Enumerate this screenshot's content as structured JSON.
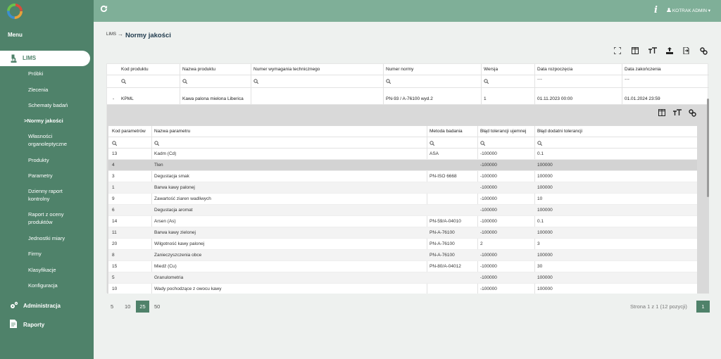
{
  "sidebar": {
    "menu_label": "Menu",
    "lims_label": "LIMS",
    "sub_items": [
      "Próbki",
      "Zlecenia",
      "Schematy badań",
      ">Normy jakości",
      "Własności",
      "organoleptyczne",
      "Produkty",
      "Parametry",
      "Dzienny raport",
      "kontrolny",
      "Raport z oceny",
      "produktów",
      "Jednostki miary",
      "Firmy",
      "Klasyfikacje",
      "Konfiguracja"
    ],
    "admin_label": "Administracja",
    "reports_label": "Raporty"
  },
  "topbar": {
    "refresh_icon": "refresh-icon",
    "info_icon": "i",
    "user_label": "KOTRAK ADMIN ▾"
  },
  "breadcrumb": {
    "root": "LIMS",
    "arrow": "→",
    "current": "Normy jakości"
  },
  "master": {
    "columns": [
      "Kod produktu",
      "Nazwa produktu",
      "Numer wymagania technicznego",
      "Numer normy",
      "Wersja",
      "Data rozpoczęcia",
      "Data zakończenia"
    ],
    "filter_date_placeholder": "---",
    "row": {
      "expander": "-",
      "code": "KPML",
      "name": "Kawa palona mielona Liberica",
      "req": "",
      "norm": "PN-93 / A-76100 wyd.2",
      "version": "1",
      "start": "01.11.2023 00:00",
      "end": "01.01.2024 23:59"
    }
  },
  "detail": {
    "columns": [
      "Kod parametrów",
      "Nazwa parametru",
      "Metoda badania",
      "Błąd tolerancji ujemnej",
      "Błąd dodatni tolerancji"
    ],
    "rows": [
      [
        "13",
        "Kadm (Cd)",
        "ASA",
        "-100000",
        "0.1"
      ],
      [
        "4",
        "Tlen",
        "",
        "-100000",
        "100000"
      ],
      [
        "3",
        "Degustacja smak",
        "PN-ISO 6668",
        "-100000",
        "100000"
      ],
      [
        "1",
        "Barwa kawy palonej",
        "",
        "-100000",
        "100000"
      ],
      [
        "9",
        "Zawartość ziaren wadliwych",
        "",
        "-100000",
        "10"
      ],
      [
        "6",
        "Degustacja aromat",
        "",
        "-100000",
        "100000"
      ],
      [
        "14",
        "Arsen (As)",
        "PN-59/A-04010",
        "-100000",
        "0.1"
      ],
      [
        "11",
        "Barwa kawy zielonej",
        "PN-A-76100",
        "-100000",
        "100000"
      ],
      [
        "20",
        "Wilgotność kawy palonej",
        "PN-A-76100",
        "2",
        "3"
      ],
      [
        "8",
        "Zanieczyszczenia obce",
        "PN-A-76100",
        "-100000",
        "100000"
      ],
      [
        "15",
        "Miedź (Cu)",
        "PN-80/A-04012",
        "-100000",
        "30"
      ],
      [
        "5",
        "Granulometria",
        "",
        "-100000",
        "100000"
      ],
      [
        "10",
        "Wady pochodzące z owocu kawy",
        "",
        "-100000",
        "100000"
      ]
    ]
  },
  "pagination": {
    "sizes": [
      "5",
      "10",
      "25",
      "50"
    ],
    "active_size": "25",
    "info": "Strona 1 z 1 (12 pozycji)",
    "page": "1"
  },
  "colors": {
    "accent": "#4f826a",
    "topbar": "#7faf98"
  }
}
